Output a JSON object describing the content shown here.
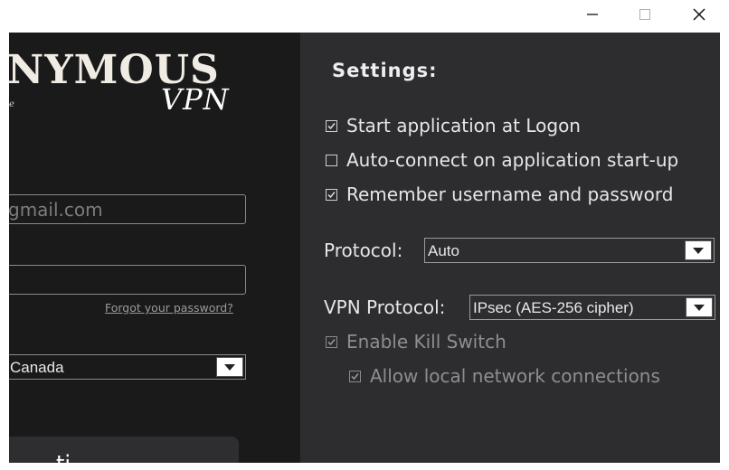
{
  "window": {
    "minimize_icon": "minimize-icon",
    "maximize_icon": "maximize-icon",
    "close_icon": "close-icon"
  },
  "left_panel": {
    "logo_text": "NYMOUS",
    "logo_sub": "VPN",
    "logo_tag": "e",
    "email_value": "gmail.com",
    "password_value": "",
    "forgot_link": "Forgot your password?",
    "country_value": "Canada",
    "connect_label": "ti"
  },
  "settings": {
    "title": "Settings:",
    "options": [
      {
        "label": "Start application at Logon",
        "checked": true
      },
      {
        "label": "Auto-connect on application start-up",
        "checked": false
      },
      {
        "label": "Remember username and password",
        "checked": true
      }
    ],
    "protocol_label": "Protocol:",
    "protocol_value": "Auto",
    "vpn_protocol_label": "VPN Protocol:",
    "vpn_protocol_value": "IPsec (AES-256 cipher)",
    "kill_switch_label": "Enable Kill Switch",
    "kill_switch_checked": true,
    "local_network_label": "Allow local network connections",
    "local_network_checked": true
  },
  "colors": {
    "left_bg": "#1a1a1a",
    "right_bg": "#2d2d30",
    "text": "#e6e6e6",
    "disabled_text": "#8e8e8e"
  }
}
